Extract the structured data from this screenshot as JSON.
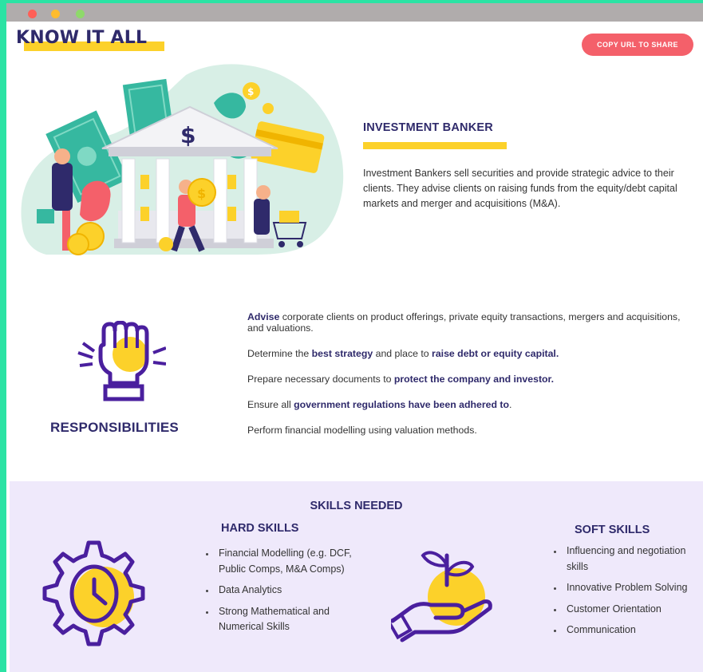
{
  "window": {
    "controls": [
      "close",
      "minimize",
      "maximize"
    ]
  },
  "header": {
    "brand": "KNOW IT ALL",
    "share_button": "COPY URL TO SHARE"
  },
  "role": {
    "title": "INVESTMENT BANKER",
    "description": "Investment Bankers sell securities and provide strategic advice to their clients. They advise clients on raising funds from the equity/debt capital markets and merger and acquisitions (M&A)."
  },
  "responsibilities": {
    "title": "RESPONSIBILITIES",
    "items": [
      {
        "parts": [
          {
            "b": "Advise"
          },
          {
            "t": " corporate clients on product offerings, private equity transactions, mergers and acquisitions, and valuations."
          }
        ]
      },
      {
        "parts": [
          {
            "t": "Determine the "
          },
          {
            "b": "best strategy"
          },
          {
            "t": " and place to "
          },
          {
            "b": "raise debt or equity capital."
          }
        ]
      },
      {
        "parts": [
          {
            "t": "Prepare necessary documents to "
          },
          {
            "b": "protect the company and investor."
          }
        ]
      },
      {
        "parts": [
          {
            "t": "Ensure all "
          },
          {
            "b": "government regulations have been adhered to"
          },
          {
            "t": "."
          }
        ]
      },
      {
        "parts": [
          {
            "t": "Perform financial modelling using valuation methods."
          }
        ]
      }
    ]
  },
  "skills": {
    "title": "SKILLS NEEDED",
    "hard": {
      "title": "HARD SKILLS",
      "items": [
        "Financial Modelling (e.g. DCF, Public Comps, M&A Comps)",
        "Data Analytics",
        "Strong Mathematical and Numerical Skills"
      ]
    },
    "soft": {
      "title": "SOFT SKILLS",
      "items": [
        "Influencing and negotiation skills",
        "Innovative Problem Solving",
        "Customer Orientation",
        "Communication"
      ]
    }
  },
  "colors": {
    "navy": "#2f2a6b",
    "yellow": "#fcd12a",
    "coral": "#f4606a",
    "teal": "#36b8a0",
    "lavender": "#efe9fb",
    "purple": "#4a1f9e"
  },
  "icons": [
    "bank-illustration-icon",
    "raised-fist-icon",
    "gear-clock-icon",
    "hand-plant-icon"
  ]
}
